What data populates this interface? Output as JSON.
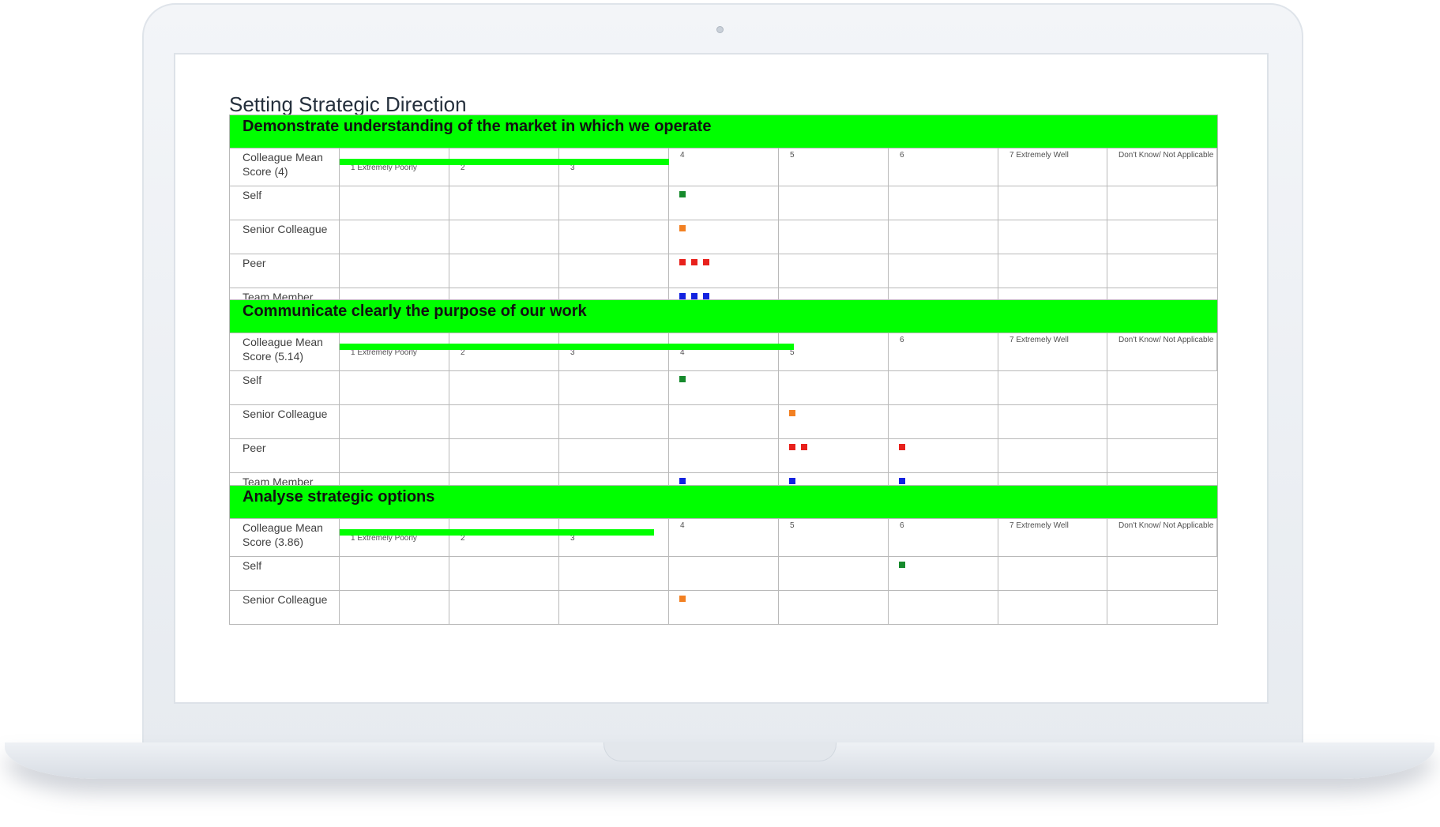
{
  "page_title": "Setting Strategic Direction",
  "scale": [
    "1 Extremely Poorly",
    "2",
    "3",
    "4",
    "5",
    "6",
    "7 Extremely Well",
    "Don't Know/ Not Applicable"
  ],
  "colors": {
    "header_bg": "#00ff00",
    "mean_bar": "#00ff00",
    "self": "#168a2c",
    "senior_colleague": "#f28022",
    "peer": "#e8211c",
    "team_member": "#1222e0"
  },
  "sections": [
    {
      "title": "Demonstrate understanding of the market in which we operate",
      "mean_label": "Colleague Mean Score (4)",
      "mean_score": 4,
      "rows": [
        {
          "label": "Self",
          "key": "self",
          "counts": {
            "4": 1
          }
        },
        {
          "label": "Senior Colleague",
          "key": "senior_colleague",
          "counts": {
            "4": 1
          }
        },
        {
          "label": "Peer",
          "key": "peer",
          "counts": {
            "4": 3
          }
        },
        {
          "label": "Team Member",
          "key": "team_member",
          "counts": {
            "4": 3
          }
        }
      ]
    },
    {
      "title": "Communicate clearly the purpose of our work",
      "mean_label": "Colleague Mean Score (5.14)",
      "mean_score": 5.14,
      "rows": [
        {
          "label": "Self",
          "key": "self",
          "counts": {
            "4": 1
          }
        },
        {
          "label": "Senior Colleague",
          "key": "senior_colleague",
          "counts": {
            "5": 1
          }
        },
        {
          "label": "Peer",
          "key": "peer",
          "counts": {
            "5": 2,
            "6": 1
          }
        },
        {
          "label": "Team Member",
          "key": "team_member",
          "counts": {
            "4": 1,
            "5": 1,
            "6": 1
          }
        }
      ]
    },
    {
      "title": "Analyse strategic options",
      "mean_label": "Colleague Mean Score (3.86)",
      "mean_score": 3.86,
      "rows": [
        {
          "label": "Self",
          "key": "self",
          "counts": {
            "6": 1
          }
        },
        {
          "label": "Senior Colleague",
          "key": "senior_colleague",
          "counts": {
            "4": 1
          }
        }
      ]
    }
  ]
}
